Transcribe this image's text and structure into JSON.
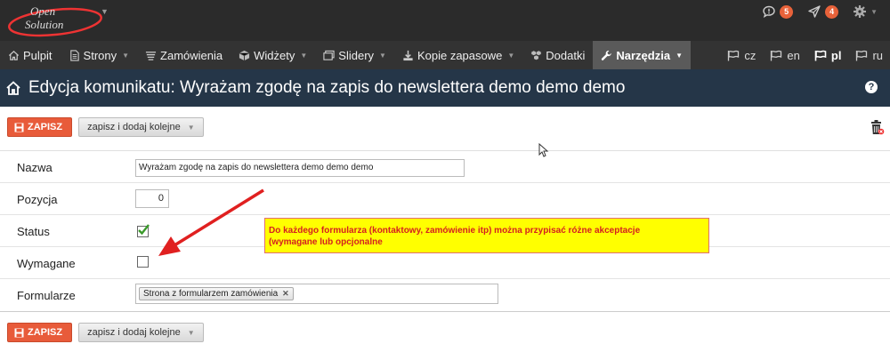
{
  "logo": {
    "line1": "Open",
    "line2": "Solution"
  },
  "topbar": {
    "messages_count": "5",
    "notifications_count": "4"
  },
  "nav": {
    "items": [
      {
        "label": "Pulpit"
      },
      {
        "label": "Strony"
      },
      {
        "label": "Zamówienia"
      },
      {
        "label": "Widżety"
      },
      {
        "label": "Slidery"
      },
      {
        "label": "Kopie zapasowe"
      },
      {
        "label": "Dodatki"
      },
      {
        "label": "Narzędzia"
      }
    ],
    "languages": [
      {
        "code": "cz"
      },
      {
        "code": "en"
      },
      {
        "code": "pl"
      },
      {
        "code": "ru"
      }
    ]
  },
  "header": {
    "title": "Edycja komunikatu: Wyrażam zgodę na zapis do newslettera demo demo demo",
    "help": "?"
  },
  "toolbar": {
    "save_label": "ZAPISZ",
    "save_add_label": "zapisz i dodaj kolejne"
  },
  "form": {
    "name": {
      "label": "Nazwa",
      "value": "Wyrażam zgodę na  zapis do newslettera  demo demo demo"
    },
    "position": {
      "label": "Pozycja",
      "value": "0"
    },
    "status": {
      "label": "Status",
      "checked": true
    },
    "required": {
      "label": "Wymagane",
      "checked": false
    },
    "forms": {
      "label": "Formularze",
      "tags": [
        "Strona z formularzem zamówienia"
      ]
    }
  },
  "annotation": {
    "line1": "Do każdego formularza (kontaktowy, zamówienie itp) można przypisać różne akceptacje",
    "line2": "(wymagane lub opcjonalne"
  },
  "colors": {
    "topbar": "#2b2b2b",
    "nav": "#333333",
    "nav_active": "#5a5a5a",
    "header": "#253648",
    "save_button": "#e85b3a",
    "badge": "#e8623a",
    "annotation_bg": "#ffff00",
    "annotation_text": "#d42020",
    "arrow": "#e02020"
  }
}
